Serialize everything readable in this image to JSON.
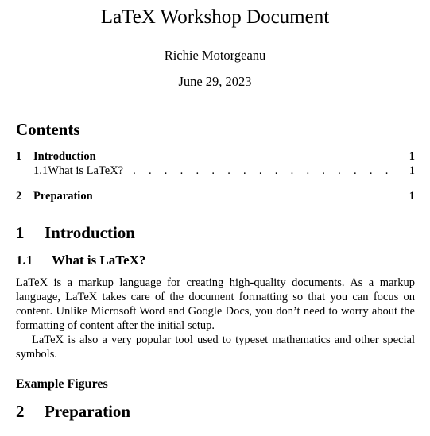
{
  "document": {
    "title": "LaTeX Workshop Document",
    "author": "Richie Motorgeanu",
    "date": "June 29, 2023"
  },
  "toc": {
    "heading": "Contents",
    "entries": [
      {
        "number": "1",
        "label": "Introduction",
        "page": "1",
        "level": "section"
      },
      {
        "number": "1.1",
        "label": "What is LaTeX?",
        "page": "1",
        "level": "subsection"
      },
      {
        "number": "2",
        "label": "Preparation",
        "page": "1",
        "level": "section"
      }
    ],
    "leader": ". . . . . . . . . . . . . . . . . . . . . . . . . . . . . ."
  },
  "body": {
    "section1": {
      "number": "1",
      "title": "Introduction"
    },
    "subsection1_1": {
      "number": "1.1",
      "title": "What is LaTeX?"
    },
    "paragraphs": [
      "LaTeX is a markup language for creating high-quality documents. As a markup language, LaTeX takes care of the document formatting so that you can focus on content. Unlike Microsoft Word and Google Docs, you don’t need to worry about the formatting of content after the initial setup.",
      "LaTeX is also a very popular tool used to typeset mathematics and other special symbols."
    ],
    "paragraph_heading": "Example Figures",
    "section2": {
      "number": "2",
      "title": "Preparation"
    }
  }
}
